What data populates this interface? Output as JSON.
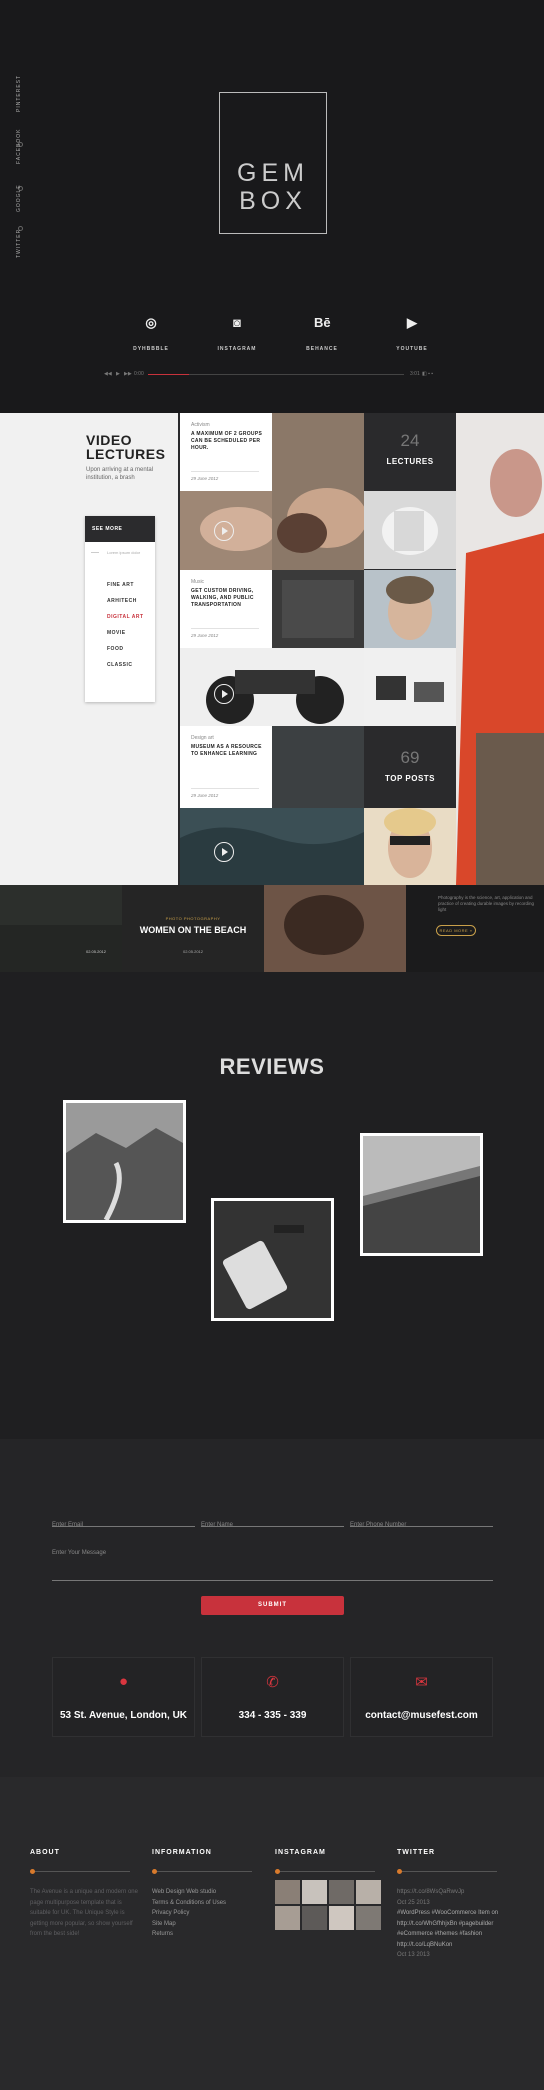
{
  "hero": {
    "side_social": [
      "PINTEREST",
      "FACEBOOK",
      "GOOGLE",
      "TWITTER"
    ],
    "logo": {
      "line1": "GEM",
      "line2": "BOX"
    },
    "social_links": [
      {
        "label": "DYHBBBLE",
        "icon": "dribbble-icon",
        "glyph": "◎"
      },
      {
        "label": "INSTAGRAM",
        "icon": "instagram-icon",
        "glyph": "◙"
      },
      {
        "label": "BEHANCE",
        "icon": "behance-icon",
        "glyph": "Bē"
      },
      {
        "label": "YOUTUBE",
        "icon": "youtube-icon",
        "glyph": "▶"
      }
    ],
    "player": {
      "time_start": "0:00",
      "time_end": "3:01",
      "progress": 0.16
    }
  },
  "magazine": {
    "title_line1": "VIDEO",
    "title_line2": "LECTURES",
    "subtitle": "Upon arriving at a mental institution, a brash",
    "menu": {
      "header": "SEE MORE",
      "search_placeholder": "Lorem ipsum dolor",
      "items": [
        "FINE ART",
        "ARHITECH",
        "DIGITAL ART",
        "MOVIE",
        "FOOD",
        "CLASSIC"
      ],
      "active_index": 2
    },
    "cards": [
      {
        "category": "Activism",
        "text": "A MAXIMUM OF 2 GROUPS CAN BE SCHEDULED PER HOUR.",
        "date": "29 June 2012"
      },
      {
        "category": "Music",
        "text": "GET CUSTOM DRIVING, WALKING, AND PUBLIC TRANSPORTATION",
        "date": "29 June 2012"
      },
      {
        "category": "Design art",
        "text": "MUSEUM AS A RESOURCE TO ENHANCE LEARNING",
        "date": "29 June 2012"
      }
    ],
    "stats": [
      {
        "number": "24",
        "label": "LECTURES"
      },
      {
        "number": "69",
        "label": "TOP POSTS"
      }
    ]
  },
  "strip": {
    "date1": "02.05.2012",
    "tag": "PHOTO PHOTOGRAPHY",
    "headline": "WOMEN ON THE BEACH",
    "date2": "02.05.2012",
    "text": "Photography is the science, art, application and practice of creating durable images by recording light",
    "button": "READ MORE »"
  },
  "reviews": {
    "title": "REVIEWS"
  },
  "contact": {
    "email_placeholder": "Enter Email",
    "name_placeholder": "Enter Name",
    "phone_placeholder": "Enter Phone Number",
    "message_placeholder": "Enter Your Message",
    "submit": "SUBMIT",
    "address": "53 St. Avenue, London, UK",
    "phone": "334 - 335 - 339",
    "email": "contact@musefest.com"
  },
  "footer": {
    "about": {
      "title": "ABOUT",
      "text": "The Avenue is a unique and modern one page multipurpose template that is suitable for UK. The Unique Style is getting more popular, so show yourself from the best side!"
    },
    "information": {
      "title": "INFORMATION",
      "links": [
        "Web Design Web studio",
        "Terms & Conditions of Uses",
        "Privacy Policy",
        "Site Map",
        "Returns"
      ]
    },
    "instagram": {
      "title": "INSTAGRAM"
    },
    "twitter": {
      "title": "TWITTER",
      "tweet1_link": "https://t.co/8WsQaRwvJp",
      "tweet1_date": "Oct 25 2013",
      "tweet2_l1": "#WordPress #WooCommerce Item on",
      "tweet2_l2": "http://t.co/WhGfhhjxBn #pagebuilder",
      "tweet2_l3": "#eCommerce #themes #fashion",
      "tweet2_l4": "http://t.co/LqBNuKon",
      "tweet2_date": "Oct 13 2013"
    }
  },
  "colors": {
    "accent": "#c8323c",
    "gold": "#c9a04a",
    "orange_dot": "#d87a2c"
  }
}
